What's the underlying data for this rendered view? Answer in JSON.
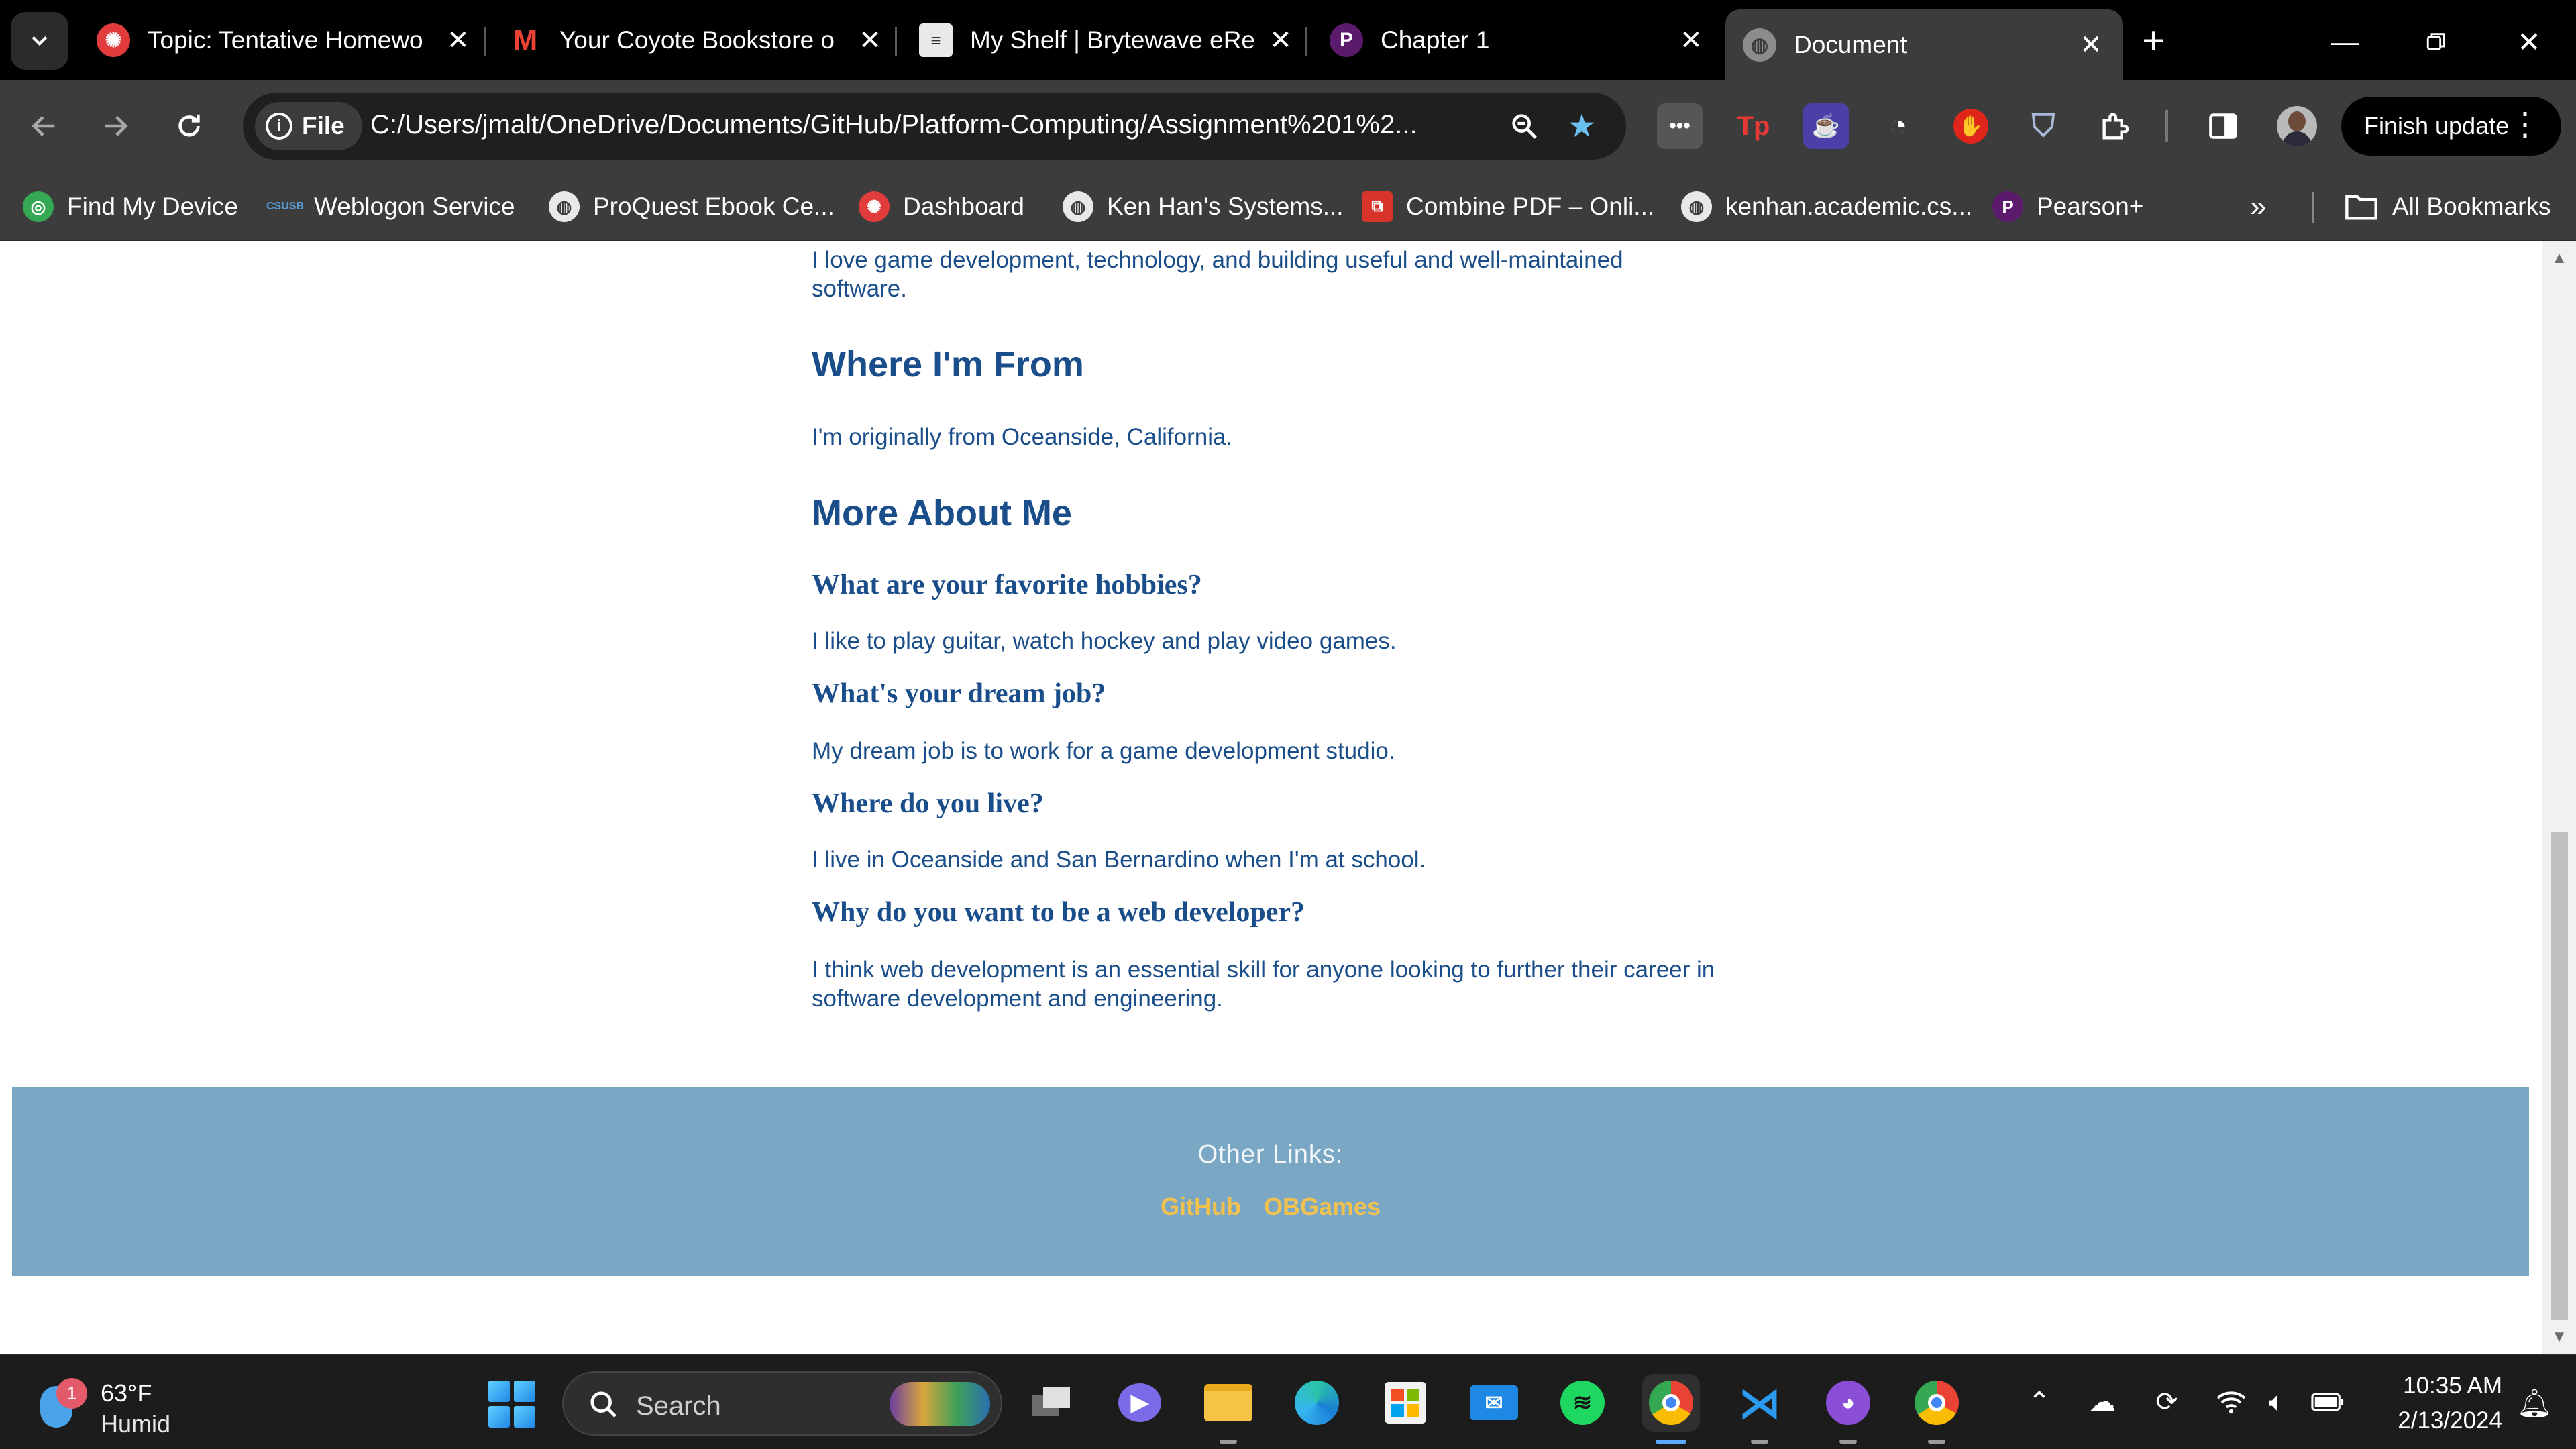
{
  "tabs": [
    {
      "title": "Topic: Tentative Homewo",
      "icon": "canvas-icon",
      "color": "#e23b3b"
    },
    {
      "title": "Your Coyote Bookstore o",
      "icon": "gmail-icon",
      "color": "#ea4335"
    },
    {
      "title": "My Shelf | Brytewave eRe",
      "icon": "document-icon",
      "color": "#e8e8e8"
    },
    {
      "title": "Chapter 1",
      "icon": "pearson-icon",
      "color": "#5b1a6b"
    },
    {
      "title": "Document",
      "icon": "globe-icon",
      "color": "#9e9e9e",
      "active": true
    }
  ],
  "toolbar": {
    "chip_label": "File",
    "url": "C:/Users/jmalt/OneDrive/Documents/GitHub/Platform-Computing/Assignment%201%2...",
    "finish_update": "Finish update"
  },
  "bookmarks": [
    {
      "label": "Find My Device",
      "icon": "find-device-icon",
      "color": "#34a853"
    },
    {
      "label": "Weblogon Service",
      "icon": "csusb-icon",
      "color": "#1f5ea8"
    },
    {
      "label": "ProQuest Ebook Ce...",
      "icon": "globe-icon",
      "color": "#e8e8e8"
    },
    {
      "label": "Dashboard",
      "icon": "canvas-icon",
      "color": "#e23b3b"
    },
    {
      "label": "Ken Han's Systems...",
      "icon": "globe-icon",
      "color": "#e8e8e8"
    },
    {
      "label": "Combine PDF – Onli...",
      "icon": "pdf-icon",
      "color": "#d9342b"
    },
    {
      "label": "kenhan.academic.cs...",
      "icon": "globe-icon",
      "color": "#e8e8e8"
    },
    {
      "label": "Pearson+",
      "icon": "pearson-icon",
      "color": "#5b1a6b"
    }
  ],
  "all_bookmarks": "All Bookmarks",
  "page": {
    "intro": "I love game development, technology, and building useful and well-maintained software.",
    "from_heading": "Where I'm From",
    "from_text": "I'm originally from Oceanside, California.",
    "more_heading": "More About Me",
    "qa": [
      {
        "q": "What are your favorite hobbies?",
        "a": "I like to play guitar, watch hockey and play video games."
      },
      {
        "q": "What's your dream job?",
        "a": "My dream job is to work for a game development studio."
      },
      {
        "q": "Where do you live?",
        "a": "I live in Oceanside and San Bernardino when I'm at school."
      },
      {
        "q": "Why do you want to be a web developer?",
        "a": "I think web development is an essential skill for anyone looking to further their career in software development and engineering."
      }
    ],
    "footer_label": "Other Links:",
    "footer_links": [
      "GitHub",
      "OBGames"
    ]
  },
  "taskbar": {
    "weather_badge": "1",
    "temperature": "63°F",
    "condition": "Humid",
    "search_placeholder": "Search",
    "time": "10:35 AM",
    "date": "2/13/2024"
  },
  "colors": {
    "heading": "#1a4e8a",
    "footer_bg": "#7aa8c4",
    "footer_link": "#f2c14e"
  }
}
